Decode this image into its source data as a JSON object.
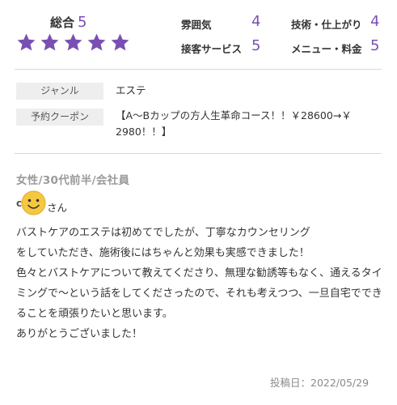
{
  "overall": {
    "label": "総合",
    "score": "5",
    "stars": 5
  },
  "ratings": {
    "atmosphere": {
      "label": "雰囲気",
      "value": "4"
    },
    "skill": {
      "label": "技術・仕上がり",
      "value": "4"
    },
    "service": {
      "label": "接客サービス",
      "value": "5"
    },
    "menu_price": {
      "label": "メニュー・料金",
      "value": "5"
    }
  },
  "info": {
    "genre_label": "ジャンル",
    "genre_value": "エステ",
    "coupon_label": "予約クーポン",
    "coupon_value": "【A〜Bカップの方人生革命コース！！￥28600→￥\n2980！！】"
  },
  "review": {
    "reviewer": "女性/30代前半/会社員",
    "nickname_initial": "c",
    "nickname_suffix": "さん",
    "body": "バストケアのエステは初めてでしたが、丁寧なカウンセリング\nをしていただき、施術後にはちゃんと効果も実感できました！\n色々とバストケアについて教えてくださり、無理な勧誘等もなく、通えるタイミングで〜という話をしてくださったので、それも考えつつ、一旦自宅でできることを頑張りたいと思います。\nありがとうございました！",
    "post_date": "投稿日：2022/05/29"
  },
  "colors": {
    "accent": "#7a4fb3",
    "label_bg": "#eeeeee",
    "avatar": "#f5c842"
  }
}
